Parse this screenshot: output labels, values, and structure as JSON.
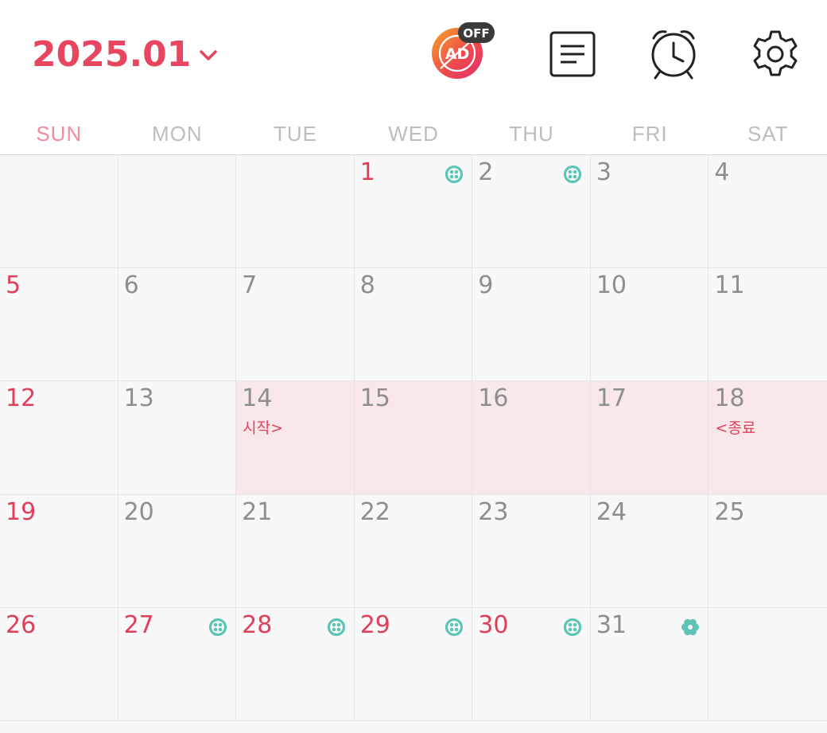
{
  "header": {
    "month_label": "2025.01",
    "ad_badge": {
      "label": "AD",
      "status": "OFF"
    }
  },
  "weekdays": [
    "SUN",
    "MON",
    "TUE",
    "WED",
    "THU",
    "FRI",
    "SAT"
  ],
  "calendar": {
    "weeks": [
      [
        {
          "day": "",
          "red": false
        },
        {
          "day": "",
          "red": false
        },
        {
          "day": "",
          "red": false
        },
        {
          "day": "1",
          "red": true,
          "icon": "flower-icon"
        },
        {
          "day": "2",
          "red": false,
          "icon": "flower-icon"
        },
        {
          "day": "3",
          "red": false
        },
        {
          "day": "4",
          "red": false
        }
      ],
      [
        {
          "day": "5",
          "red": true
        },
        {
          "day": "6",
          "red": false
        },
        {
          "day": "7",
          "red": false
        },
        {
          "day": "8",
          "red": false
        },
        {
          "day": "9",
          "red": false
        },
        {
          "day": "10",
          "red": false
        },
        {
          "day": "11",
          "red": false
        }
      ],
      [
        {
          "day": "12",
          "red": true
        },
        {
          "day": "13",
          "red": false
        },
        {
          "day": "14",
          "red": false,
          "range": true,
          "label": "시작>"
        },
        {
          "day": "15",
          "red": false,
          "range": true
        },
        {
          "day": "16",
          "red": false,
          "range": true
        },
        {
          "day": "17",
          "red": false,
          "range": true
        },
        {
          "day": "18",
          "red": false,
          "range": true,
          "label": "<종료"
        }
      ],
      [
        {
          "day": "19",
          "red": true
        },
        {
          "day": "20",
          "red": false
        },
        {
          "day": "21",
          "red": false
        },
        {
          "day": "22",
          "red": false
        },
        {
          "day": "23",
          "red": false
        },
        {
          "day": "24",
          "red": false
        },
        {
          "day": "25",
          "red": false
        }
      ],
      [
        {
          "day": "26",
          "red": true
        },
        {
          "day": "27",
          "red": true,
          "icon": "flower-icon"
        },
        {
          "day": "28",
          "red": true,
          "icon": "flower-icon"
        },
        {
          "day": "29",
          "red": true,
          "icon": "flower-icon"
        },
        {
          "day": "30",
          "red": true,
          "icon": "flower-icon"
        },
        {
          "day": "31",
          "red": false,
          "icon": "gear-flower-icon"
        },
        {
          "day": "",
          "red": false
        }
      ]
    ]
  },
  "colors": {
    "accent": "#e8455f",
    "sunday_header": "#f08c9c",
    "range_bg": "#f9e8ea",
    "teal_icon": "#5fc4b8"
  }
}
